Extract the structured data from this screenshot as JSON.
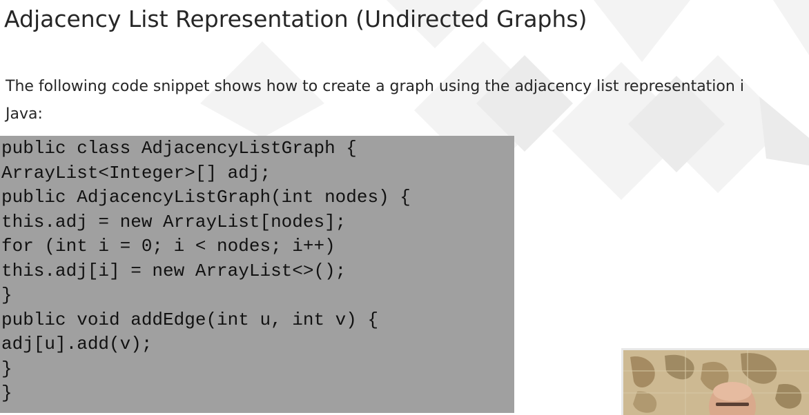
{
  "slide": {
    "title": "Adjacency List Representation (Undirected Graphs)",
    "intro_line_1": "The following code snippet shows how to create a graph using the adjacency list representation i",
    "intro_line_2": "Java:"
  },
  "code": {
    "lines": [
      "public class AdjacencyListGraph {",
      "ArrayList<Integer>[] adj;",
      "public AdjacencyListGraph(int nodes) {",
      "this.adj = new ArrayList[nodes];",
      "for (int i = 0; i < nodes; i++)",
      "this.adj[i] = new ArrayList<>();",
      "}",
      "public void addEdge(int u, int v) {",
      "adj[u].add(v);",
      "}",
      "}"
    ]
  },
  "colors": {
    "code_background": "#a0a0a0",
    "text": "#262626"
  },
  "icons": {
    "presenter": "presenter-webcam-feed"
  }
}
